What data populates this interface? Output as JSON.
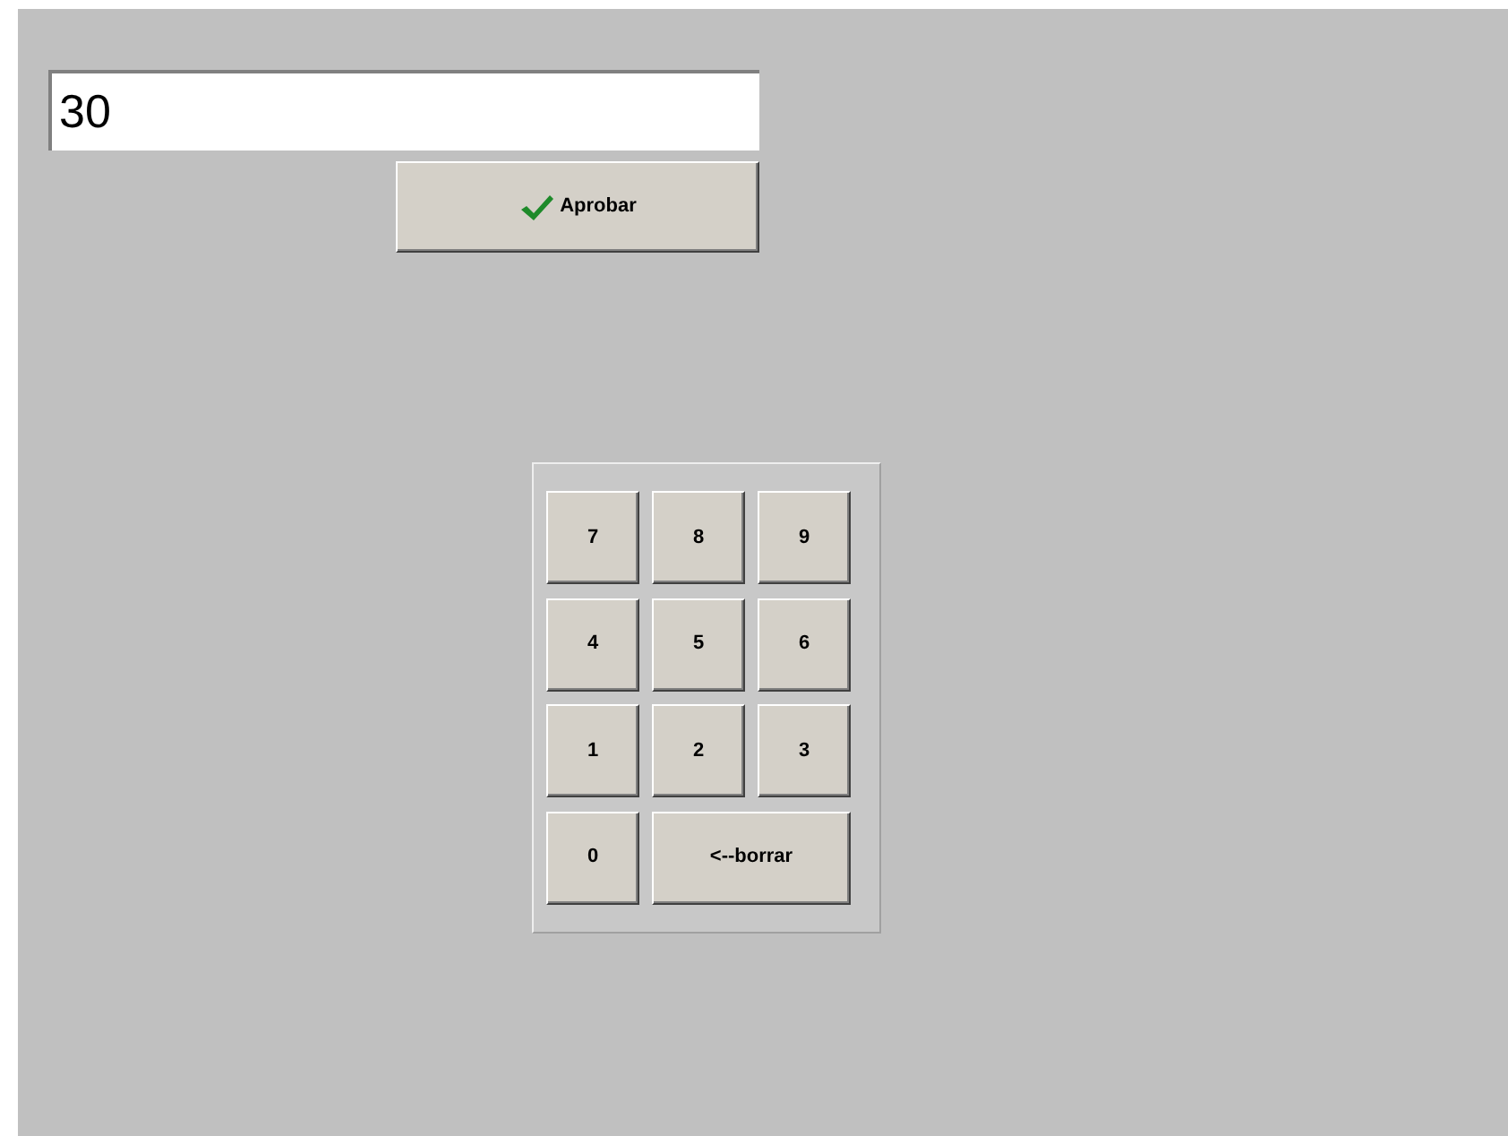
{
  "entry": {
    "value": "30"
  },
  "approve_button": {
    "label": "Aprobar"
  },
  "keypad": [
    {
      "label": "7",
      "kind": "digit"
    },
    {
      "label": "8",
      "kind": "digit"
    },
    {
      "label": "9",
      "kind": "digit"
    },
    {
      "label": "4",
      "kind": "digit"
    },
    {
      "label": "5",
      "kind": "digit"
    },
    {
      "label": "6",
      "kind": "digit"
    },
    {
      "label": "1",
      "kind": "digit"
    },
    {
      "label": "2",
      "kind": "digit"
    },
    {
      "label": "3",
      "kind": "digit"
    },
    {
      "label": "0",
      "kind": "digit"
    },
    {
      "label": "<--borrar",
      "kind": "wide"
    }
  ]
}
